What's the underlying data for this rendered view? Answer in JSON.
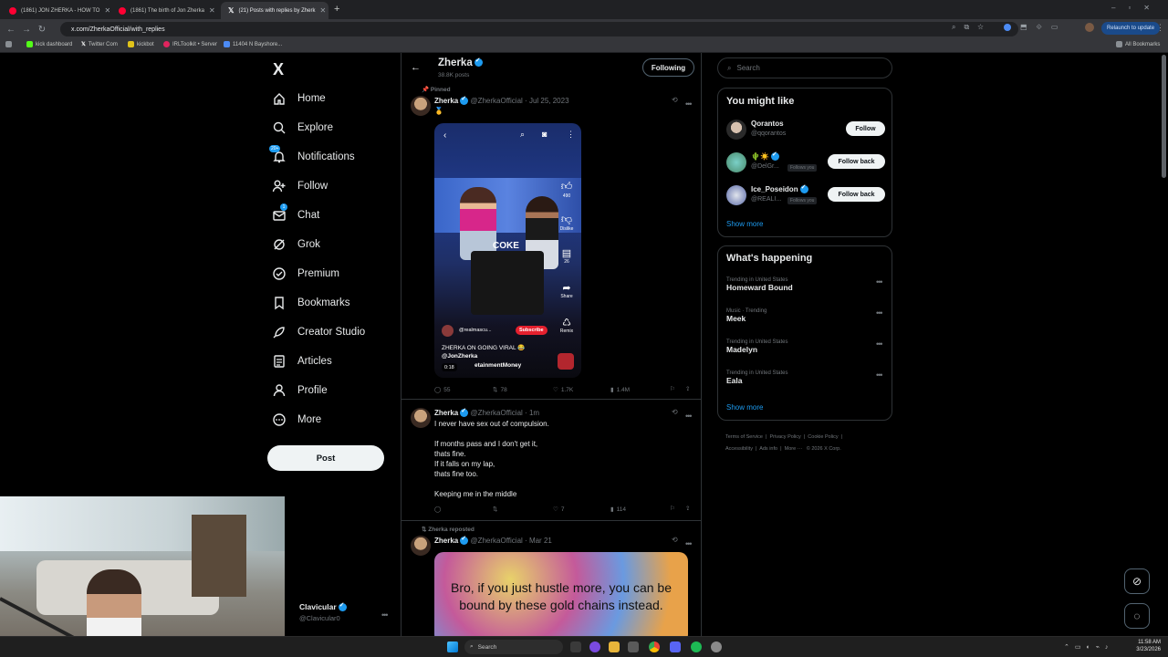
{
  "browser": {
    "tabs": [
      {
        "title": "(1861) JON ZHERKA - HOW TO"
      },
      {
        "title": "(1861) The birth of Jon Zherka"
      },
      {
        "title": "(21) Posts with replies by Zherk"
      }
    ],
    "url": "x.com/ZherkaOfficial/with_replies",
    "relaunch_label": "Relaunch to update",
    "bookmarks": [
      {
        "label": "kick dashboard"
      },
      {
        "label": "Twitter Com"
      },
      {
        "label": "kickbot"
      },
      {
        "label": "IRLToolkit • Server"
      },
      {
        "label": "11404 N Bayshore..."
      }
    ],
    "all_bookmarks": "All Bookmarks"
  },
  "nav": {
    "logo": "X",
    "items": [
      {
        "label": "Home",
        "icon": "home-icon"
      },
      {
        "label": "Explore",
        "icon": "search-icon"
      },
      {
        "label": "Notifications",
        "icon": "bell-icon",
        "badge": "20+"
      },
      {
        "label": "Follow",
        "icon": "add-user-icon"
      },
      {
        "label": "Chat",
        "icon": "mail-icon",
        "badge": "1"
      },
      {
        "label": "Grok",
        "icon": "grok-icon"
      },
      {
        "label": "Premium",
        "icon": "premium-icon"
      },
      {
        "label": "Bookmarks",
        "icon": "bookmark-icon"
      },
      {
        "label": "Creator Studio",
        "icon": "rocket-icon"
      },
      {
        "label": "Articles",
        "icon": "article-icon"
      },
      {
        "label": "Profile",
        "icon": "person-icon"
      },
      {
        "label": "More",
        "icon": "more-circle-icon"
      }
    ],
    "post_label": "Post",
    "account": {
      "name": "Clavicular",
      "handle": "@Clavicular0"
    }
  },
  "profile_header": {
    "name": "Zherka",
    "posts_count": "38.8K posts",
    "following_label": "Following"
  },
  "posts": [
    {
      "pinned_label": "Pinned",
      "name": "Zherka",
      "handle": "@ZherkaOfficial",
      "date": "Jul 25, 2023",
      "text": "🥇",
      "video": {
        "overlay_word": "COKE",
        "like_count": "490",
        "dislike_label": "Dislike",
        "comment_count": "26",
        "share_label": "Share",
        "remix_label": "Remix",
        "channel": "@realmascu...",
        "subscribe_label": "Subscribe",
        "caption_line1": "ZHERKA ON GOING VIRAL 😂",
        "caption_line2": "@JonZherka",
        "caption_line3": "etainmentMoney",
        "timestamp": "0:18"
      },
      "replies": "55",
      "reposts": "78",
      "likes": "1.7K",
      "views": "1.4M"
    },
    {
      "name": "Zherka",
      "handle": "@ZherkaOfficial",
      "date": "1m",
      "lines": [
        "I never have sex out of compulsion.",
        "",
        "If months pass and I don't get it,",
        "thats fine.",
        "If it falls on my lap,",
        "thats fine too.",
        "",
        "Keeping me in the middle"
      ],
      "replies": "",
      "reposts": "",
      "likes": "7",
      "views": "114"
    },
    {
      "repost_label": "Zherka reposted",
      "name": "Zherka",
      "handle": "@ZherkaOfficial",
      "date": "Mar 21",
      "image_text": "Bro, if you just hustle more, you can be bound by these gold chains instead."
    }
  ],
  "right": {
    "search_placeholder": "Search",
    "who_to_follow": {
      "title": "You might like",
      "users": [
        {
          "name": "Qorantos",
          "handle": "@qqorantos",
          "button": "Follow",
          "follows_you": ""
        },
        {
          "name": "🌵☀️",
          "handle": "@DelGr...",
          "button": "Follow back",
          "follows_you": "Follows you"
        },
        {
          "name": "Ice_Poseidon",
          "handle": "@REALI...",
          "button": "Follow back",
          "follows_you": "Follows you"
        }
      ],
      "show_more": "Show more"
    },
    "happening": {
      "title": "What's happening",
      "trends": [
        {
          "meta": "Trending in United States",
          "name": "Homeward Bound"
        },
        {
          "meta": "Music · Trending",
          "name": "Meek"
        },
        {
          "meta": "Trending in United States",
          "name": "Madelyn"
        },
        {
          "meta": "Trending in United States",
          "name": "Eala"
        }
      ],
      "show_more": "Show more"
    },
    "footer": {
      "links": [
        "Terms of Service",
        "Privacy Policy",
        "Cookie Policy",
        "Accessibility",
        "Ads info",
        "More ···"
      ],
      "copyright": "© 2026 X Corp."
    }
  },
  "taskbar": {
    "search_placeholder": "Search",
    "time": "11:58 AM",
    "date": "3/23/2026"
  }
}
